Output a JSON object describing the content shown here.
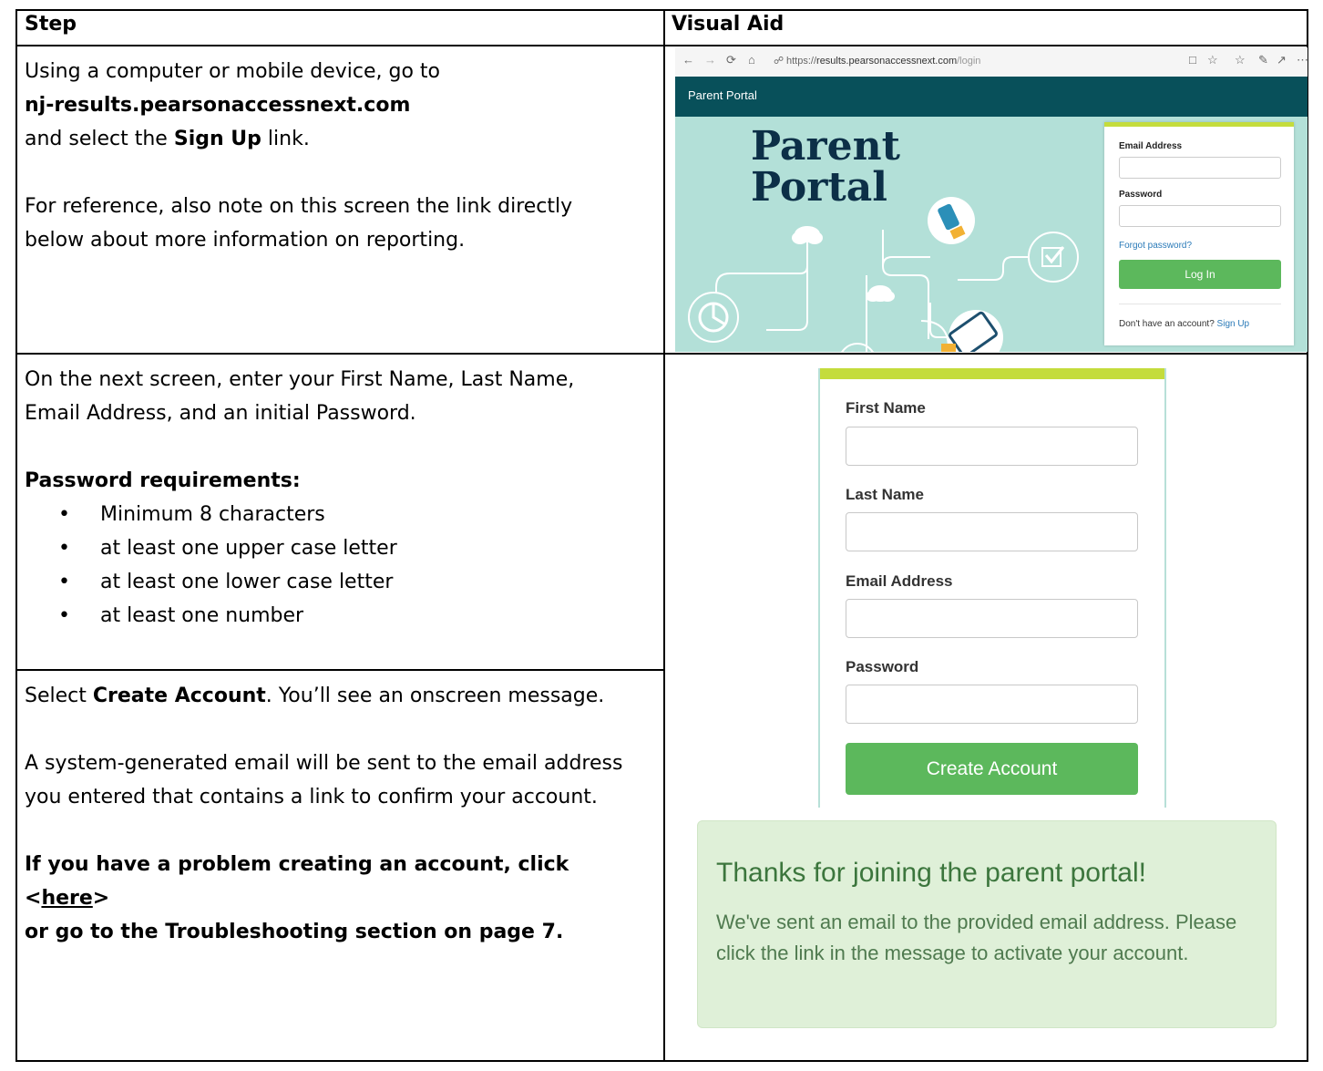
{
  "header": {
    "step": "Step",
    "visual_aid": "Visual Aid"
  },
  "row1": {
    "line1": "Using a computer or mobile device, go to",
    "url": "nj-results.pearsonaccessnext.com",
    "line3_pre": "and select the ",
    "line3_bold": "Sign Up",
    "line3_post": " link.",
    "note": "For reference, also note on this screen the link directly below about more information on reporting."
  },
  "row2": {
    "intro": "On the next screen, enter your First Name, Last Name, Email Address, and an initial Password.",
    "req_title": "Password requirements:",
    "requirements": [
      "Minimum 8 characters",
      "at least one upper case letter",
      "at least one lower case letter",
      "at least one number"
    ]
  },
  "row3": {
    "select_pre": "Select ",
    "select_bold": "Create Account",
    "select_post": ". You’ll see an onscreen message.",
    "email_note": "A system-generated email will be sent to the email address you entered that contains a link to confirm your account.",
    "problem_pre": "If you have a problem creating an account, click <",
    "problem_link": "here",
    "problem_mid": ">",
    "problem_post": "or go to the Troubleshooting section on page 7."
  },
  "login_screenshot": {
    "url_prefix": "https://",
    "url_domain": "results.pearsonaccessnext.com",
    "url_path": "/login",
    "portal_bar": "Parent Portal",
    "big_title_line1": "Parent",
    "big_title_line2": "Portal",
    "email_label": "Email Address",
    "password_label": "Password",
    "forgot": "Forgot password?",
    "login_button": "Log In",
    "no_account": "Don't have an account? ",
    "signup_link": "Sign Up"
  },
  "create_form": {
    "first_name": "First Name",
    "last_name": "Last Name",
    "email": "Email Address",
    "password": "Password",
    "create_button": "Create Account"
  },
  "thanks_message": {
    "title": "Thanks for joining the parent portal!",
    "body": "We've sent an email to the provided email address. Please click the link in the message to activate your account."
  },
  "colors": {
    "portal_bar": "#08505a",
    "portal_bg": "#b3e0d8",
    "accent_green": "#5cb85c",
    "panel_top": "#c4dc3c",
    "link_blue": "#2a7ab8",
    "success_bg": "#dff0d8",
    "success_text": "#3c763d"
  }
}
